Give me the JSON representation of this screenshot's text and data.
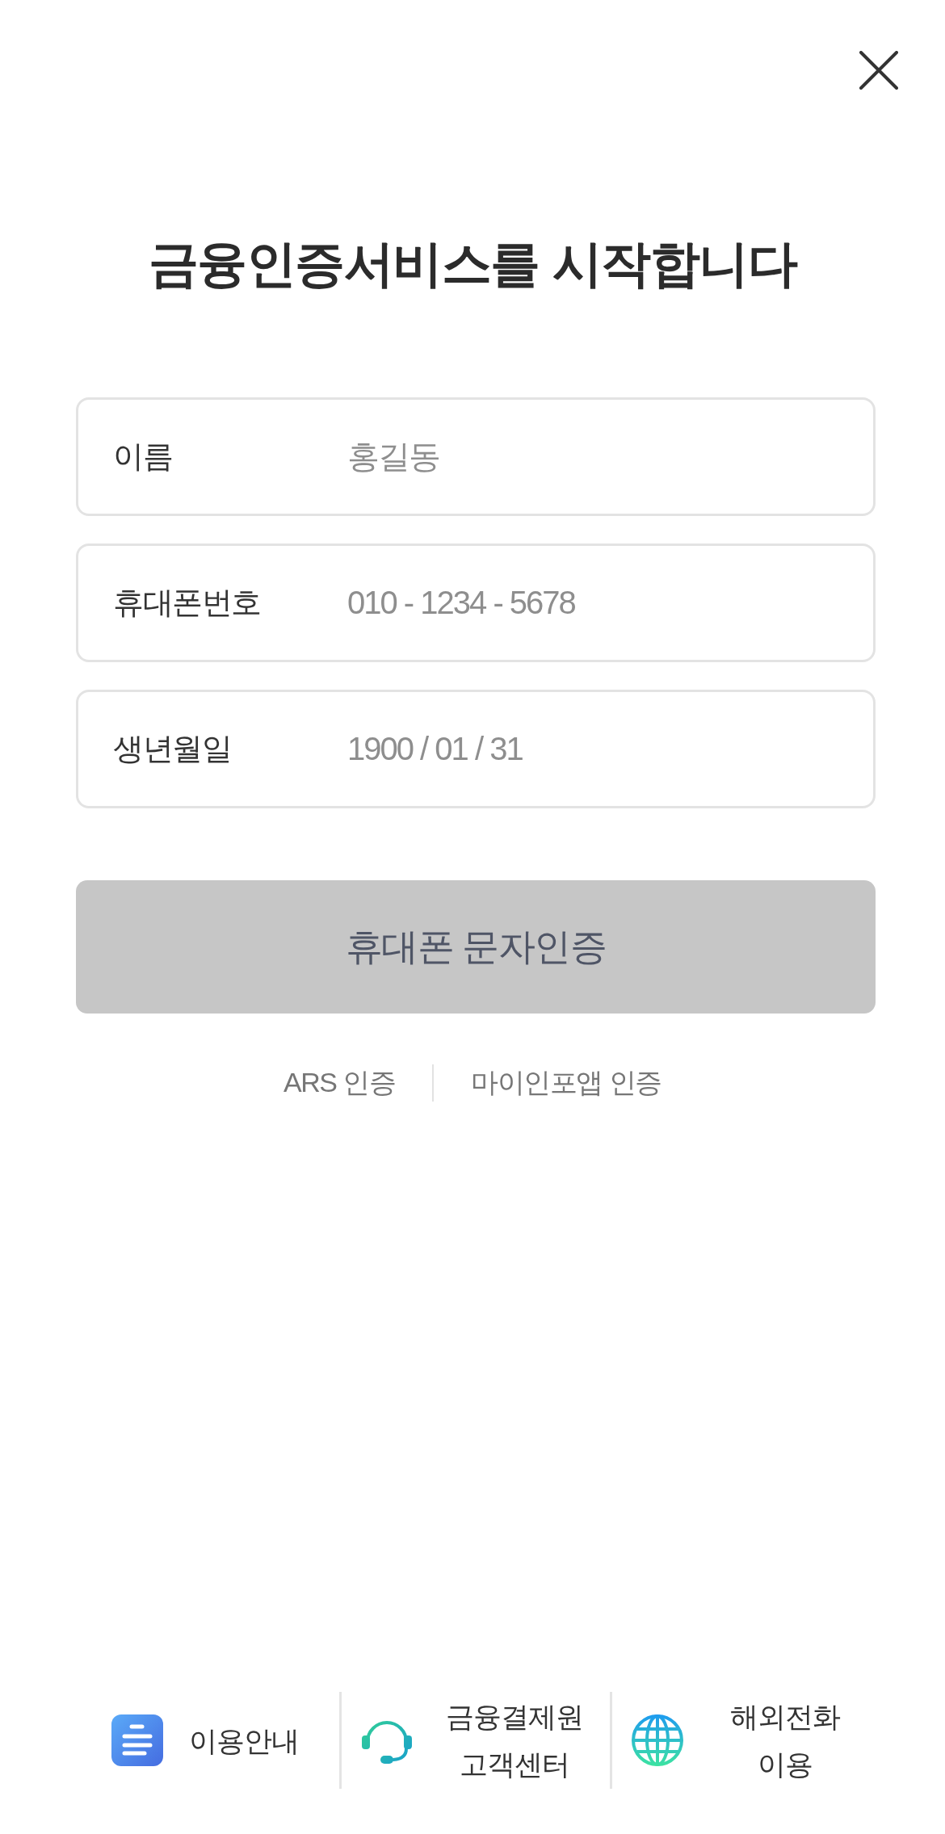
{
  "title": "금융인증서비스를 시작합니다",
  "fields": [
    {
      "label": "이름",
      "placeholder": "홍길동"
    },
    {
      "label": "휴대폰번호",
      "placeholder": "010 - 1234 - 5678"
    },
    {
      "label": "생년월일",
      "placeholder": "1900 / 01 / 31"
    }
  ],
  "submit_button": {
    "label": "휴대폰 문자인증",
    "disabled": true
  },
  "alt_methods": [
    {
      "label": "ARS 인증"
    },
    {
      "label": "마이인포앱 인증"
    }
  ],
  "footer": [
    {
      "label": "이용안내"
    },
    {
      "label": "금융결제원 고객센터"
    },
    {
      "label": "해외전화 이용"
    }
  ]
}
